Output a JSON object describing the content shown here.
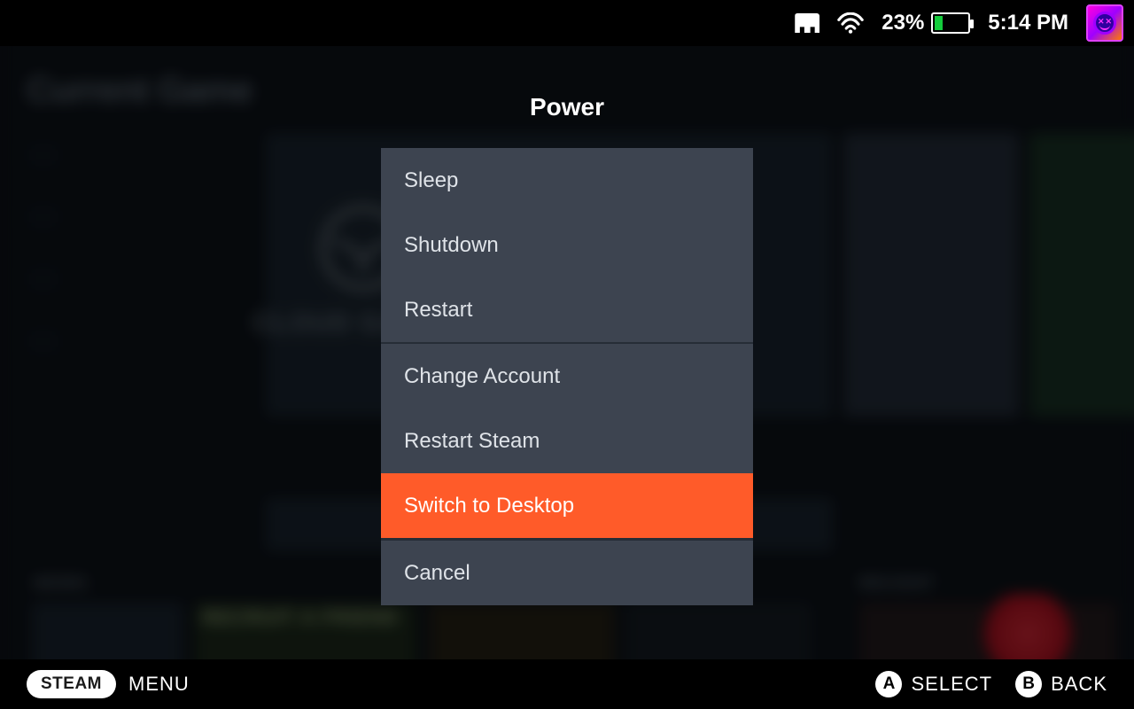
{
  "statusbar": {
    "icons": {
      "sd": "sd-card-icon",
      "wifi": "wifi-icon"
    },
    "battery_percent": "23%",
    "battery_fill_pct": 23,
    "battery_color": "#14cc3c",
    "time": "5:14 PM",
    "avatar_name": "user-avatar"
  },
  "background": {
    "heading": "Current Game",
    "big_tile_label": "CLOUD GAMING",
    "news_label": "NEWS",
    "right_label": "RECENT",
    "recruit_label": "RECRUIT A FRIEND"
  },
  "power_menu": {
    "title": "Power",
    "groups": [
      [
        {
          "id": "sleep",
          "label": "Sleep",
          "selected": false
        },
        {
          "id": "shutdown",
          "label": "Shutdown",
          "selected": false
        },
        {
          "id": "restart",
          "label": "Restart",
          "selected": false
        }
      ],
      [
        {
          "id": "change-account",
          "label": "Change Account",
          "selected": false
        },
        {
          "id": "restart-steam",
          "label": "Restart Steam",
          "selected": false
        },
        {
          "id": "switch-desktop",
          "label": "Switch to Desktop",
          "selected": true
        }
      ],
      [
        {
          "id": "cancel",
          "label": "Cancel",
          "selected": false
        }
      ]
    ]
  },
  "footer": {
    "steam_label": "STEAM",
    "menu_label": "MENU",
    "a_glyph": "A",
    "a_label": "SELECT",
    "b_glyph": "B",
    "b_label": "BACK"
  },
  "colors": {
    "accent_selected": "#ff5b29",
    "menu_bg": "#3d4450"
  }
}
